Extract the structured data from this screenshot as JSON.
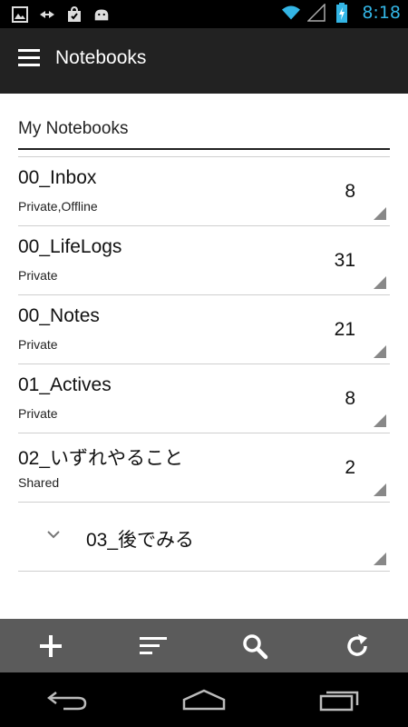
{
  "status_bar": {
    "time": "8:18",
    "left_icons": [
      "image-icon",
      "usb-debug-icon",
      "shopping-bag-icon",
      "android-icon"
    ],
    "right_icons": [
      "wifi-icon",
      "signal-icon",
      "battery-charging-icon"
    ],
    "accent_color": "#33b5e5"
  },
  "action_bar": {
    "title": "Notebooks",
    "menu_icon": "menu-icon"
  },
  "section": {
    "header": "My Notebooks"
  },
  "notebooks": [
    {
      "name": "00_Inbox",
      "sub": "Private,Offline",
      "count": "8"
    },
    {
      "name": "00_LifeLogs",
      "sub": "Private",
      "count": "31"
    },
    {
      "name": "00_Notes",
      "sub": "Private",
      "count": "21"
    },
    {
      "name": "01_Actives",
      "sub": "Private",
      "count": "8"
    },
    {
      "name": "02_いずれやること",
      "sub": "Shared",
      "count": "2"
    }
  ],
  "stack": {
    "name": "03_後でみる",
    "icon": "chevron-down-icon"
  },
  "bottom_bar": {
    "buttons": [
      "add-icon",
      "sort-icon",
      "search-icon",
      "refresh-icon"
    ]
  },
  "nav_bar": {
    "buttons": [
      "back-icon",
      "home-icon",
      "recent-apps-icon"
    ]
  }
}
